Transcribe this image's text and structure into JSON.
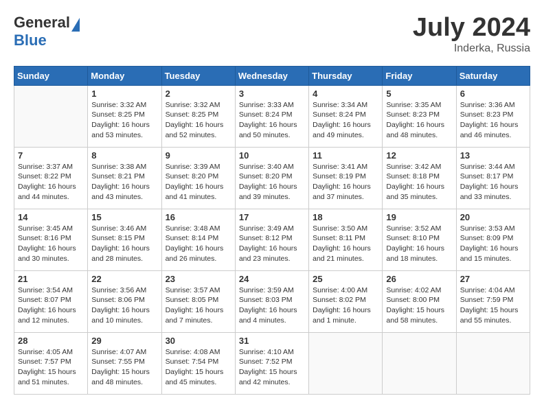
{
  "header": {
    "logo_general": "General",
    "logo_blue": "Blue",
    "month_year": "July 2024",
    "location": "Inderka, Russia"
  },
  "days_of_week": [
    "Sunday",
    "Monday",
    "Tuesday",
    "Wednesday",
    "Thursday",
    "Friday",
    "Saturday"
  ],
  "weeks": [
    [
      {
        "day": "",
        "content": ""
      },
      {
        "day": "1",
        "content": "Sunrise: 3:32 AM\nSunset: 8:25 PM\nDaylight: 16 hours\nand 53 minutes."
      },
      {
        "day": "2",
        "content": "Sunrise: 3:32 AM\nSunset: 8:25 PM\nDaylight: 16 hours\nand 52 minutes."
      },
      {
        "day": "3",
        "content": "Sunrise: 3:33 AM\nSunset: 8:24 PM\nDaylight: 16 hours\nand 50 minutes."
      },
      {
        "day": "4",
        "content": "Sunrise: 3:34 AM\nSunset: 8:24 PM\nDaylight: 16 hours\nand 49 minutes."
      },
      {
        "day": "5",
        "content": "Sunrise: 3:35 AM\nSunset: 8:23 PM\nDaylight: 16 hours\nand 48 minutes."
      },
      {
        "day": "6",
        "content": "Sunrise: 3:36 AM\nSunset: 8:23 PM\nDaylight: 16 hours\nand 46 minutes."
      }
    ],
    [
      {
        "day": "7",
        "content": "Sunrise: 3:37 AM\nSunset: 8:22 PM\nDaylight: 16 hours\nand 44 minutes."
      },
      {
        "day": "8",
        "content": "Sunrise: 3:38 AM\nSunset: 8:21 PM\nDaylight: 16 hours\nand 43 minutes."
      },
      {
        "day": "9",
        "content": "Sunrise: 3:39 AM\nSunset: 8:20 PM\nDaylight: 16 hours\nand 41 minutes."
      },
      {
        "day": "10",
        "content": "Sunrise: 3:40 AM\nSunset: 8:20 PM\nDaylight: 16 hours\nand 39 minutes."
      },
      {
        "day": "11",
        "content": "Sunrise: 3:41 AM\nSunset: 8:19 PM\nDaylight: 16 hours\nand 37 minutes."
      },
      {
        "day": "12",
        "content": "Sunrise: 3:42 AM\nSunset: 8:18 PM\nDaylight: 16 hours\nand 35 minutes."
      },
      {
        "day": "13",
        "content": "Sunrise: 3:44 AM\nSunset: 8:17 PM\nDaylight: 16 hours\nand 33 minutes."
      }
    ],
    [
      {
        "day": "14",
        "content": "Sunrise: 3:45 AM\nSunset: 8:16 PM\nDaylight: 16 hours\nand 30 minutes."
      },
      {
        "day": "15",
        "content": "Sunrise: 3:46 AM\nSunset: 8:15 PM\nDaylight: 16 hours\nand 28 minutes."
      },
      {
        "day": "16",
        "content": "Sunrise: 3:48 AM\nSunset: 8:14 PM\nDaylight: 16 hours\nand 26 minutes."
      },
      {
        "day": "17",
        "content": "Sunrise: 3:49 AM\nSunset: 8:12 PM\nDaylight: 16 hours\nand 23 minutes."
      },
      {
        "day": "18",
        "content": "Sunrise: 3:50 AM\nSunset: 8:11 PM\nDaylight: 16 hours\nand 21 minutes."
      },
      {
        "day": "19",
        "content": "Sunrise: 3:52 AM\nSunset: 8:10 PM\nDaylight: 16 hours\nand 18 minutes."
      },
      {
        "day": "20",
        "content": "Sunrise: 3:53 AM\nSunset: 8:09 PM\nDaylight: 16 hours\nand 15 minutes."
      }
    ],
    [
      {
        "day": "21",
        "content": "Sunrise: 3:54 AM\nSunset: 8:07 PM\nDaylight: 16 hours\nand 12 minutes."
      },
      {
        "day": "22",
        "content": "Sunrise: 3:56 AM\nSunset: 8:06 PM\nDaylight: 16 hours\nand 10 minutes."
      },
      {
        "day": "23",
        "content": "Sunrise: 3:57 AM\nSunset: 8:05 PM\nDaylight: 16 hours\nand 7 minutes."
      },
      {
        "day": "24",
        "content": "Sunrise: 3:59 AM\nSunset: 8:03 PM\nDaylight: 16 hours\nand 4 minutes."
      },
      {
        "day": "25",
        "content": "Sunrise: 4:00 AM\nSunset: 8:02 PM\nDaylight: 16 hours\nand 1 minute."
      },
      {
        "day": "26",
        "content": "Sunrise: 4:02 AM\nSunset: 8:00 PM\nDaylight: 15 hours\nand 58 minutes."
      },
      {
        "day": "27",
        "content": "Sunrise: 4:04 AM\nSunset: 7:59 PM\nDaylight: 15 hours\nand 55 minutes."
      }
    ],
    [
      {
        "day": "28",
        "content": "Sunrise: 4:05 AM\nSunset: 7:57 PM\nDaylight: 15 hours\nand 51 minutes."
      },
      {
        "day": "29",
        "content": "Sunrise: 4:07 AM\nSunset: 7:55 PM\nDaylight: 15 hours\nand 48 minutes."
      },
      {
        "day": "30",
        "content": "Sunrise: 4:08 AM\nSunset: 7:54 PM\nDaylight: 15 hours\nand 45 minutes."
      },
      {
        "day": "31",
        "content": "Sunrise: 4:10 AM\nSunset: 7:52 PM\nDaylight: 15 hours\nand 42 minutes."
      },
      {
        "day": "",
        "content": ""
      },
      {
        "day": "",
        "content": ""
      },
      {
        "day": "",
        "content": ""
      }
    ]
  ]
}
